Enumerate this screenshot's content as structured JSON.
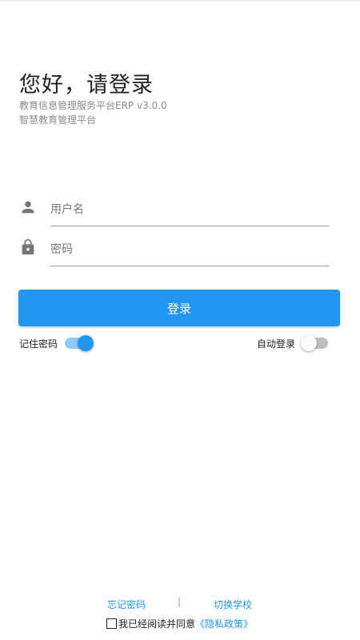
{
  "header": {
    "title": "您好，请登录",
    "subtitle_line1": "教育信息管理服务平台ERP v3.0.0",
    "subtitle_line2": "智慧教育管理平台"
  },
  "form": {
    "username": {
      "placeholder": "用户名",
      "value": "",
      "icon": "person-icon"
    },
    "password": {
      "placeholder": "密码",
      "value": "",
      "icon": "lock-icon"
    },
    "login_label": "登录"
  },
  "options": {
    "remember_password": {
      "label": "记住密码",
      "on": true
    },
    "auto_login": {
      "label": "自动登录",
      "on": false
    }
  },
  "footer": {
    "forgot_password": "忘记密码",
    "separator": "|",
    "switch_school": "切换学校",
    "agree_text": "我已经阅读并同意",
    "privacy_link": "《隐私政策》",
    "agree_checked": false
  },
  "colors": {
    "accent": "#2196f3",
    "switch_track_on": "#90caf9",
    "switch_track_off": "#bdbdbd"
  }
}
